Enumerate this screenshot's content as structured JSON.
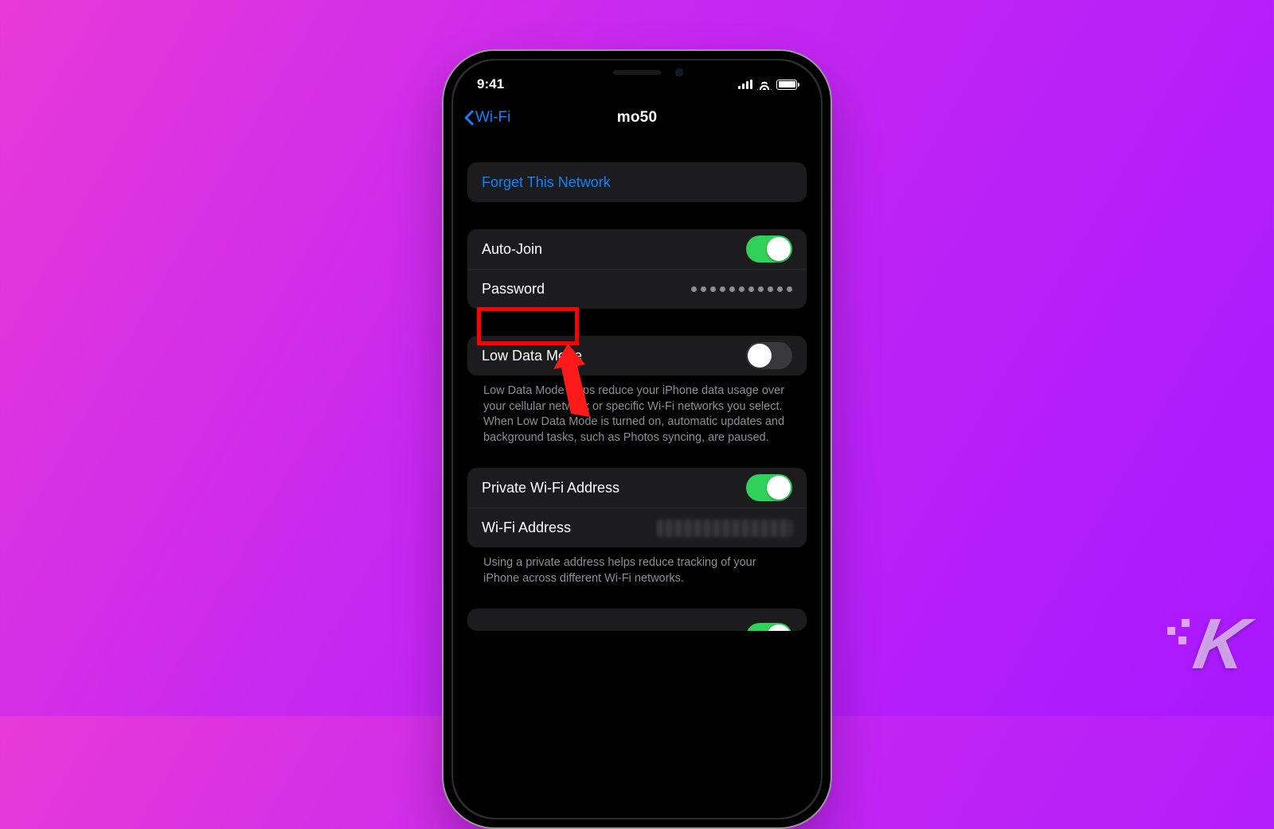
{
  "status": {
    "time": "9:41"
  },
  "nav": {
    "back_label": "Wi-Fi",
    "title": "mo50"
  },
  "sections": {
    "forget": {
      "label": "Forget This Network"
    },
    "auto_join": {
      "label": "Auto-Join",
      "on": true
    },
    "password": {
      "label": "Password",
      "masked_value": "•••••••••••"
    },
    "low_data": {
      "label": "Low Data Mode",
      "on": false,
      "note": "Low Data Mode helps reduce your iPhone data usage over your cellular network or specific Wi-Fi networks you select. When Low Data Mode is turned on, automatic updates and background tasks, such as Photos syncing, are paused."
    },
    "private_addr": {
      "label": "Private Wi-Fi Address",
      "on": true
    },
    "wifi_addr": {
      "label": "Wi-Fi Address"
    },
    "private_note": "Using a private address helps reduce tracking of your iPhone across different Wi-Fi networks."
  },
  "annotation": {
    "highlight": "Password"
  },
  "watermark": "K"
}
